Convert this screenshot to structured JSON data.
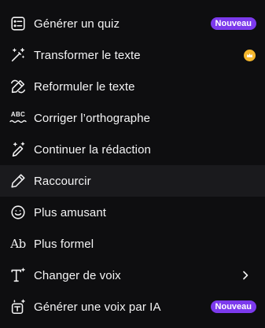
{
  "menu": {
    "items": [
      {
        "icon": "quiz-list-icon",
        "label": "Générer un quiz",
        "badge": "Nouveau"
      },
      {
        "icon": "magic-wand-icon",
        "label": "Transformer le texte",
        "premium": "crown-icon"
      },
      {
        "icon": "rewrite-pen-icon",
        "label": "Reformuler le texte"
      },
      {
        "icon": "abc-spellcheck-icon",
        "label": "Corriger l’orthographe",
        "icon_text": "ABC"
      },
      {
        "icon": "pen-sparkle-icon",
        "label": "Continuer la rédaction"
      },
      {
        "icon": "pencil-icon",
        "label": "Raccourcir",
        "hovered": true
      },
      {
        "icon": "smiley-icon",
        "label": "Plus amusant"
      },
      {
        "icon": "ab-typography-icon",
        "label": "Plus formel",
        "icon_text": "Ab"
      },
      {
        "icon": "text-sparkle-icon",
        "label": "Changer de voix",
        "submenu": "chevron-right-icon"
      },
      {
        "icon": "ai-voice-icon",
        "label": "Générer une voix par IA",
        "badge": "Nouveau"
      }
    ]
  },
  "colors": {
    "background": "#0e0e10",
    "hover": "#1a1a1d",
    "text": "#f4f4f5",
    "badge": "#7c3aed",
    "crown": "#f5b72d"
  }
}
